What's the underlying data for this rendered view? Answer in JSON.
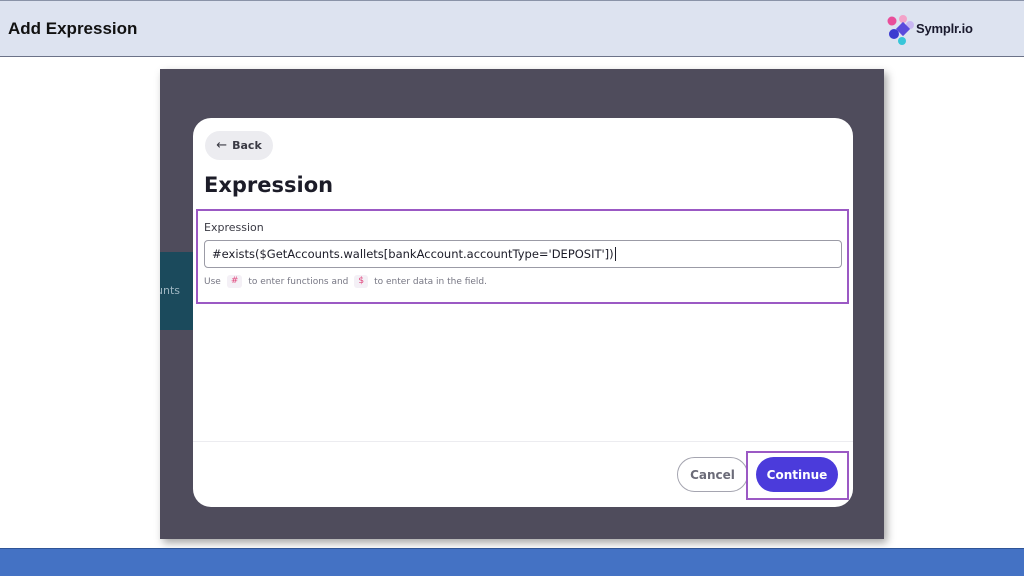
{
  "slide": {
    "title": "Add Expression",
    "logo_text": "Symplr.io",
    "colors": {
      "header_bg": "#dde3f0",
      "footer_bg": "#4472c4",
      "highlight": "#9b59c4",
      "primary_button": "#4b3bdb",
      "backdrop": "#4f4c5c"
    }
  },
  "background": {
    "card_text": "unts"
  },
  "modal": {
    "back_label": "Back",
    "back_icon": "arrow-left-icon",
    "title": "Expression",
    "field_label": "Expression",
    "expression_value": "#exists($GetAccounts.wallets[bankAccount.accountType='DEPOSIT'])",
    "hint": {
      "prefix": "Use",
      "function_symbol": "#",
      "middle": "to enter functions and",
      "data_symbol": "$",
      "suffix": "to enter data in the field."
    },
    "cancel_label": "Cancel",
    "continue_label": "Continue"
  }
}
